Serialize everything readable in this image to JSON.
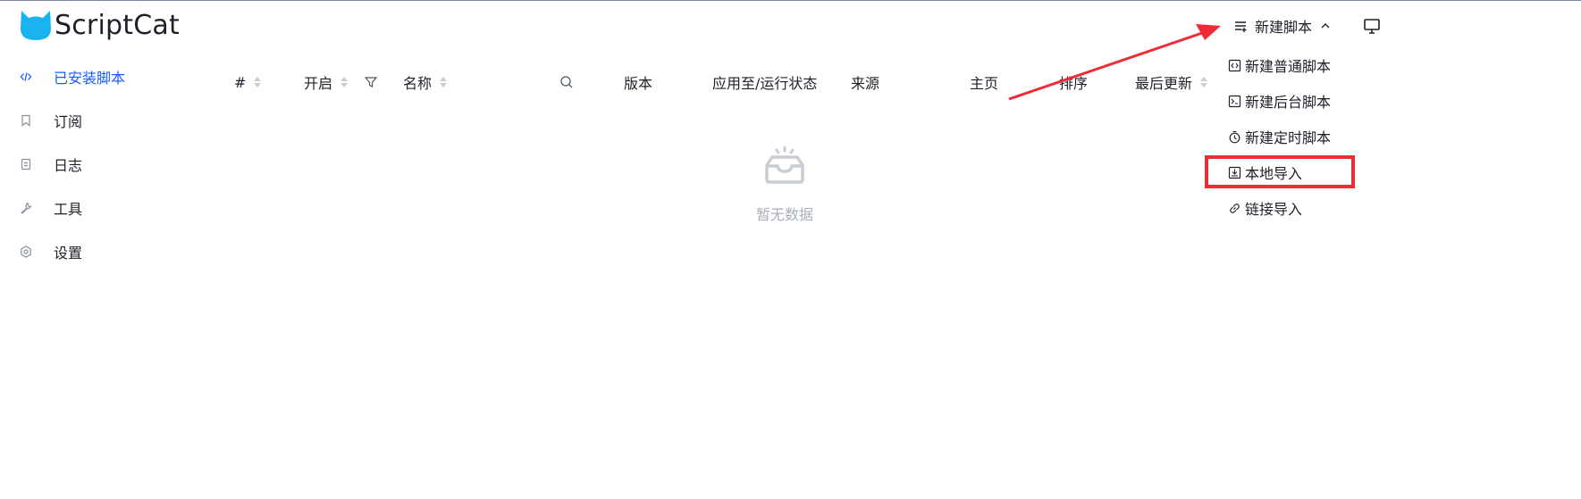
{
  "header": {
    "app_title": "ScriptCat",
    "new_script_label": "新建脚本",
    "new_script_icon": "list-add-icon",
    "expand_icon": "chevron-up-icon",
    "monitor_icon": "monitor-icon"
  },
  "sidebar": {
    "items": [
      {
        "label": "已安装脚本",
        "icon": "code-icon",
        "active": true
      },
      {
        "label": "订阅",
        "icon": "bookmark-icon",
        "active": false
      },
      {
        "label": "日志",
        "icon": "file-icon",
        "active": false
      },
      {
        "label": "工具",
        "icon": "wrench-icon",
        "active": false
      },
      {
        "label": "设置",
        "icon": "settings-icon",
        "active": false
      }
    ]
  },
  "table": {
    "columns": {
      "index": "#",
      "enabled": "开启",
      "name": "名称",
      "version": "版本",
      "apply_status": "应用至/运行状态",
      "source": "来源",
      "homepage": "主页",
      "sort": "排序",
      "last_updated": "最后更新"
    },
    "empty_text": "暂无数据"
  },
  "menu": {
    "items": [
      {
        "label": "新建普通脚本",
        "icon": "code-square-icon"
      },
      {
        "label": "新建后台脚本",
        "icon": "terminal-icon"
      },
      {
        "label": "新建定时脚本",
        "icon": "timer-icon"
      },
      {
        "label": "本地导入",
        "icon": "import-icon"
      },
      {
        "label": "链接导入",
        "icon": "link-icon"
      }
    ]
  },
  "colors": {
    "accent": "#165dff",
    "annotation_red": "#ef2b36",
    "logo_blue": "#1ab3f0"
  }
}
